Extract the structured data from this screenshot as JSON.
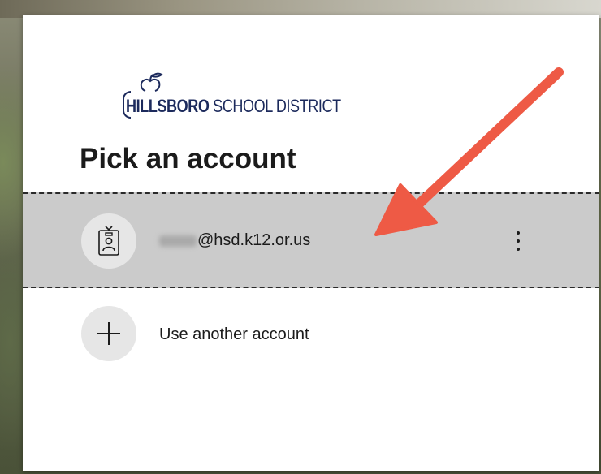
{
  "logo": {
    "text_bold": "HILLSBORO",
    "text_regular": "SCHOOL DISTRICT"
  },
  "title": "Pick an account",
  "account": {
    "email_visible": "@hsd.k12.or.us",
    "icon": "id-badge-icon"
  },
  "another_account": {
    "label": "Use another account",
    "icon": "plus-icon"
  },
  "colors": {
    "selected_row_bg": "#cbcbcb",
    "annotation_arrow": "#ee5a45",
    "brand_navy": "#1c2a5c"
  }
}
